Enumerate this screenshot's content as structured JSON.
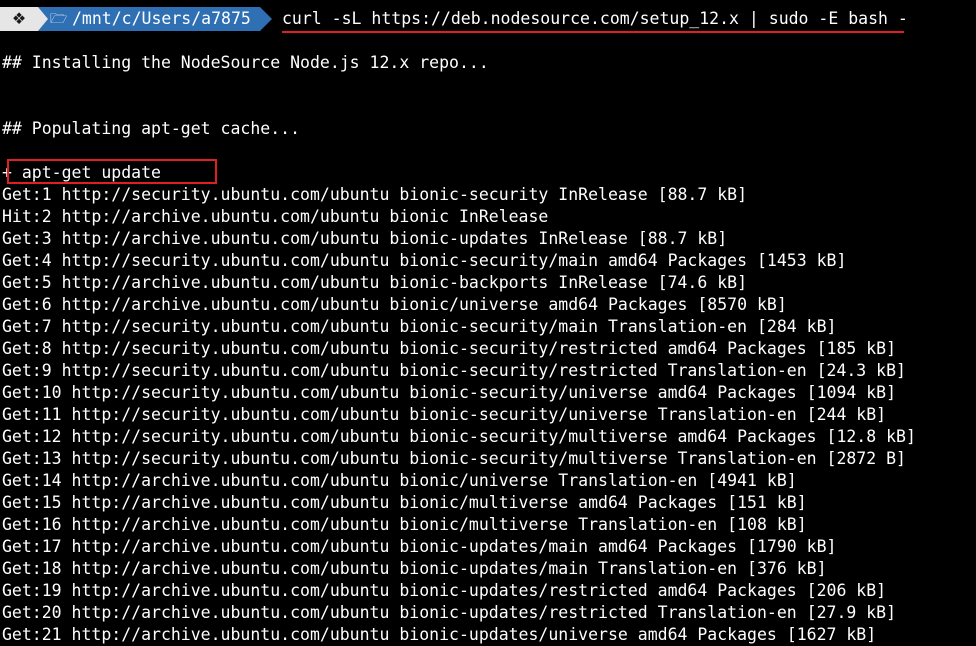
{
  "prompt": {
    "os_icon": "windows-icon",
    "folder_icon": "folder-icon",
    "path": "/mnt/c/Users/a7875",
    "command": "curl -sL https://deb.nodesource.com/setup_12.x | sudo -E bash -"
  },
  "output": {
    "installing": "## Installing the NodeSource Node.js 12.x repo...",
    "populating": "## Populating apt-get cache...",
    "apt_update": "+ apt-get update",
    "lines": [
      "Get:1 http://security.ubuntu.com/ubuntu bionic-security InRelease [88.7 kB]",
      "Hit:2 http://archive.ubuntu.com/ubuntu bionic InRelease",
      "Get:3 http://archive.ubuntu.com/ubuntu bionic-updates InRelease [88.7 kB]",
      "Get:4 http://security.ubuntu.com/ubuntu bionic-security/main amd64 Packages [1453 kB]",
      "Get:5 http://archive.ubuntu.com/ubuntu bionic-backports InRelease [74.6 kB]",
      "Get:6 http://archive.ubuntu.com/ubuntu bionic/universe amd64 Packages [8570 kB]",
      "Get:7 http://security.ubuntu.com/ubuntu bionic-security/main Translation-en [284 kB]",
      "Get:8 http://security.ubuntu.com/ubuntu bionic-security/restricted amd64 Packages [185 kB]",
      "Get:9 http://security.ubuntu.com/ubuntu bionic-security/restricted Translation-en [24.3 kB]",
      "Get:10 http://security.ubuntu.com/ubuntu bionic-security/universe amd64 Packages [1094 kB]",
      "Get:11 http://security.ubuntu.com/ubuntu bionic-security/universe Translation-en [244 kB]",
      "Get:12 http://security.ubuntu.com/ubuntu bionic-security/multiverse amd64 Packages [12.8 kB]",
      "Get:13 http://security.ubuntu.com/ubuntu bionic-security/multiverse Translation-en [2872 B]",
      "Get:14 http://archive.ubuntu.com/ubuntu bionic/universe Translation-en [4941 kB]",
      "Get:15 http://archive.ubuntu.com/ubuntu bionic/multiverse amd64 Packages [151 kB]",
      "Get:16 http://archive.ubuntu.com/ubuntu bionic/multiverse Translation-en [108 kB]",
      "Get:17 http://archive.ubuntu.com/ubuntu bionic-updates/main amd64 Packages [1790 kB]",
      "Get:18 http://archive.ubuntu.com/ubuntu bionic-updates/main Translation-en [376 kB]",
      "Get:19 http://archive.ubuntu.com/ubuntu bionic-updates/restricted amd64 Packages [206 kB]",
      "Get:20 http://archive.ubuntu.com/ubuntu bionic-updates/restricted Translation-en [27.9 kB]",
      "Get:21 http://archive.ubuntu.com/ubuntu bionic-updates/universe amd64 Packages [1627 kB]"
    ]
  },
  "colors": {
    "background": "#000000",
    "text": "#ffffff",
    "path_segment": "#2f6fb3",
    "os_segment": "#e6e6e6",
    "annotation": "#e02020"
  }
}
